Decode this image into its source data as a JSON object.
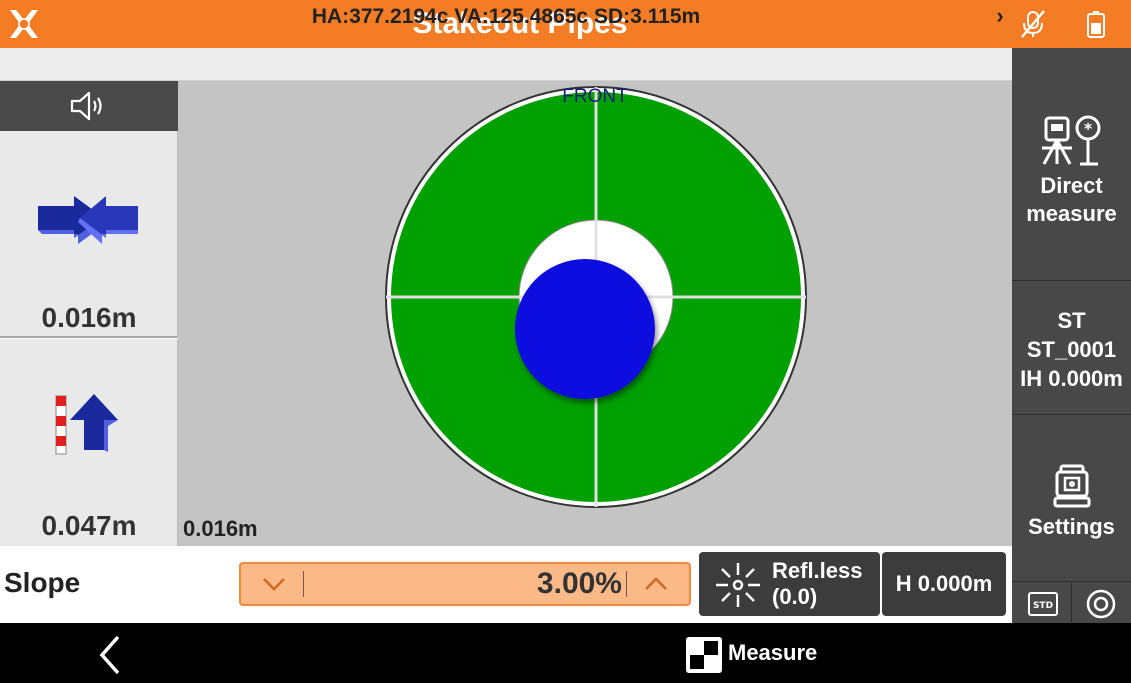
{
  "header": {
    "title": "Stakeout Pipes",
    "color": "#f47c24",
    "icons": [
      "app-logo-icon",
      "mic-off-icon",
      "battery-icon"
    ]
  },
  "info_bar": {
    "text": "HA:377.2194c  VA:125.4865c  SD:3.115m",
    "chevron": "›"
  },
  "target": {
    "front_label": "FRONT",
    "distance": "0.016m",
    "outer_color": "#00a000",
    "ball_color": "#1010e0"
  },
  "left_panel": {
    "speaker_icon": "speaker-icon",
    "horizontal_offset": "0.016m",
    "vertical_offset": "0.047m"
  },
  "right_panel": {
    "direct_measure_label": "Direct measure",
    "station_line1": "ST",
    "station_line2": "ST_0001",
    "station_line3": "IH 0.000m",
    "settings_label": "Settings",
    "std_label": "STD"
  },
  "controls": {
    "slope_label": "Slope",
    "slope_value": "3.00%",
    "refl_line1": "Refl.less",
    "refl_line2": "(0.0)",
    "h_label": "H 0.000m"
  },
  "navbar": {
    "measure_label": "Measure"
  }
}
